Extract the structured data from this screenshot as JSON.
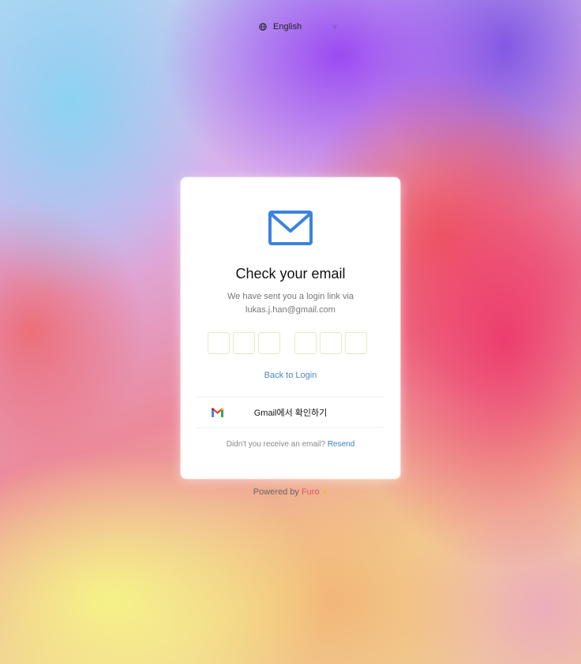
{
  "language": {
    "selected": "English",
    "icon": "globe-icon",
    "chevron": "chevron-down-icon"
  },
  "card": {
    "icon": "mail-icon",
    "title": "Check your email",
    "subtitle_line1": "We have sent you a login link via",
    "subtitle_line2": "lukas.j.han@gmail.com",
    "code_boxes": [
      "",
      "",
      "",
      "",
      "",
      ""
    ],
    "back_link": "Back to Login",
    "gmail_button": {
      "label": "Gmail에서 확인하기",
      "icon": "gmail-icon"
    },
    "resend_prompt": "Didn't you receive an email?",
    "resend_link": "Resend"
  },
  "footer": {
    "powered_by": "Powered by",
    "brand": "Furo",
    "brand_mark": "✦"
  },
  "colors": {
    "accent_blue": "#3d7fb8",
    "mail_icon": "#3b82e0",
    "brand": "#e2506f"
  }
}
